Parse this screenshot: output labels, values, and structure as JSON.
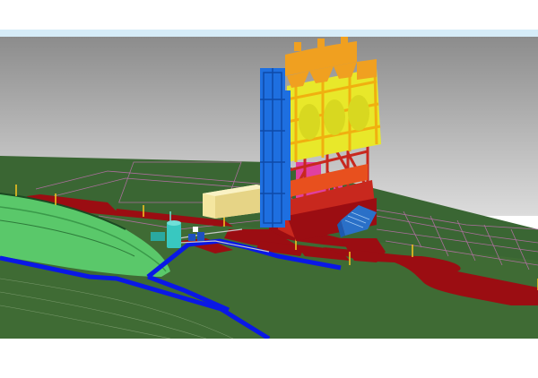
{
  "viewport": {
    "sky_top": "#8c8c8c",
    "sky_bottom": "#dcdcdc",
    "title_bar_color": "#d6ecf8",
    "ground_color": "#3f6b34",
    "ground_far_color": "#3a6633",
    "road_color": "#9b0d12",
    "conveyor_color": "#1e6fe0",
    "silo_color": "#e8e82a",
    "hopper_color": "#f0a020",
    "frame_red": "#c8281e",
    "magenta_color": "#e040a0",
    "warehouse_color": "#f4e6a0",
    "water_channel_color": "#0a18e6",
    "embankment_color": "#5ac86a",
    "truck_color": "#2a70c8",
    "tank_color": "#38c8c0",
    "grid_line_color": "#c070b0"
  }
}
